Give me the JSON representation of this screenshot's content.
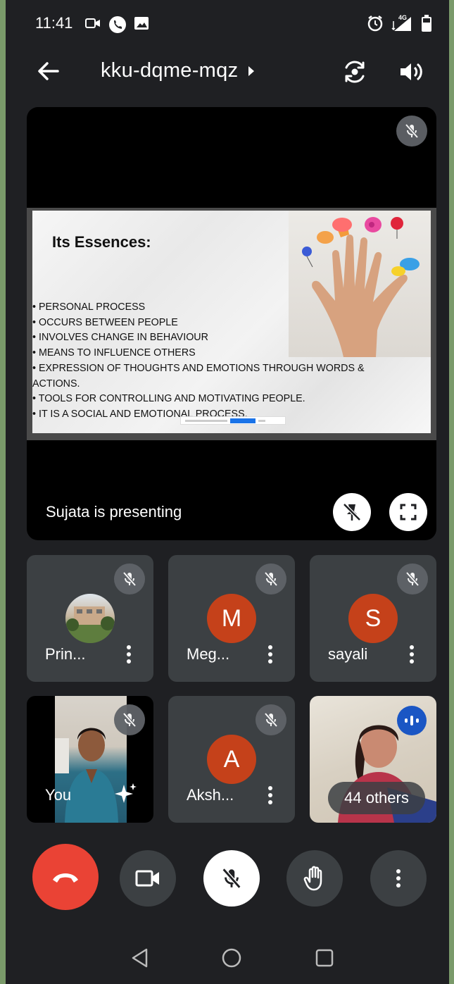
{
  "status_bar": {
    "time": "11:41",
    "network": "4G"
  },
  "header": {
    "meeting_code": "kku-dqme-mqz"
  },
  "presentation": {
    "slide_title": "Its Essences:",
    "bullets": [
      "• PERSONAL PROCESS",
      "• OCCURS BETWEEN PEOPLE",
      "• INVOLVES CHANGE IN BEHAVIOUR",
      "• MEANS TO INFLUENCE OTHERS",
      "• EXPRESSION OF THOUGHTS AND EMOTIONS THROUGH WORDS &",
      "ACTIONS.",
      "• TOOLS FOR CONTROLLING AND MOTIVATING PEOPLE.",
      "• IT IS A SOCIAL AND EMOTIONAL PROCESS."
    ],
    "presenter_label": "Sujata is presenting"
  },
  "participants": [
    {
      "name": "Prin...",
      "avatar_letter": "",
      "muted": true
    },
    {
      "name": "Meg...",
      "avatar_letter": "M",
      "muted": true
    },
    {
      "name": "sayali",
      "avatar_letter": "S",
      "muted": true
    },
    {
      "name": "You",
      "avatar_letter": "",
      "muted": true
    },
    {
      "name": "Aksh...",
      "avatar_letter": "A",
      "muted": true
    }
  ],
  "others_label": "44 others",
  "colors": {
    "end_call": "#ea4335",
    "avatar": "#c5411a",
    "speaking": "#1a56c4",
    "tile": "#3c4043"
  }
}
